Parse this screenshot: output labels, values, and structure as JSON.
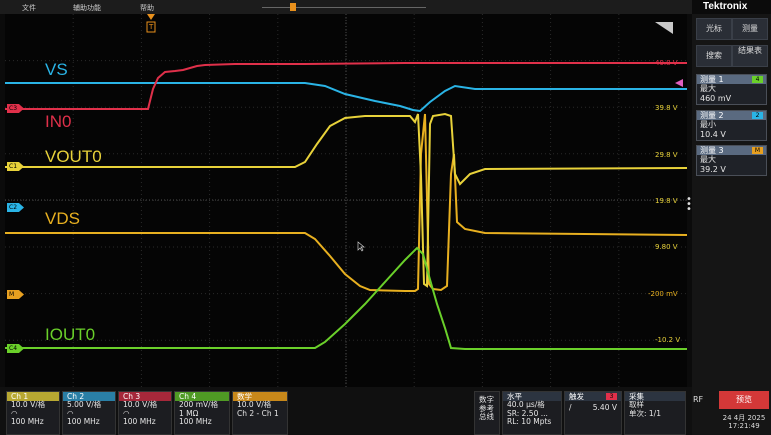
{
  "menu": {
    "file": "文件",
    "assist": "辅助功能",
    "help": "帮助"
  },
  "brand": "Tektronix",
  "signals": [
    {
      "id": "vs",
      "label": "VS",
      "color": "#2ab4e6"
    },
    {
      "id": "in0",
      "label": "IN0",
      "color": "#e0304a"
    },
    {
      "id": "vout0",
      "label": "VOUT0",
      "color": "#e8d23a"
    },
    {
      "id": "vds",
      "label": "VDS",
      "color": "#e8b020"
    },
    {
      "id": "iout0",
      "label": "IOUT0",
      "color": "#6ad02a"
    }
  ],
  "scale_labels": [
    "49.8 V",
    "39.8 V",
    "29.8 V",
    "19.8 V",
    "9.80 V",
    "-200 mV",
    "-10.2 V"
  ],
  "channel_markers": [
    "C3",
    "C1",
    "C2",
    "M",
    "C4"
  ],
  "trigger_marker": "T",
  "right_panel": {
    "buttons": [
      "光标",
      "测量",
      "搜索",
      "结果表"
    ],
    "measurements": [
      {
        "title": "测量 1",
        "badge": "4",
        "badge_color": "#6ad02a",
        "kind": "最大",
        "value": "460 mV"
      },
      {
        "title": "测量 2",
        "badge": "2",
        "badge_color": "#2ab4e6",
        "kind": "最小",
        "value": "10.4 V"
      },
      {
        "title": "测量 3",
        "badge": "M",
        "badge_color": "#e8a020",
        "kind": "最大",
        "value": "39.2 V"
      }
    ]
  },
  "channels": [
    {
      "name": "Ch 1",
      "scale": "10.0 V/格",
      "coupling": "◠",
      "bw": "100 MHz",
      "color": "#b8a832"
    },
    {
      "name": "Ch 2",
      "scale": "5.00 V/格",
      "coupling": "◠",
      "bw": "100 MHz",
      "color": "#2a7fa6"
    },
    {
      "name": "Ch 3",
      "scale": "10.0 V/格",
      "coupling": "◠",
      "bw": "100 MHz",
      "color": "#a6283a"
    },
    {
      "name": "Ch 4",
      "scale": "200 mV/格",
      "coupling": "1 MΩ",
      "bw": "100 MHz",
      "color": "#4f9a24"
    }
  ],
  "math": {
    "name": "数学",
    "scale": "10.0 V/格",
    "expr": "Ch 2 - Ch 1",
    "color": "#c8881a"
  },
  "ref_math": [
    "数字",
    "参考",
    "总线"
  ],
  "horizontal": {
    "title": "水平",
    "scale": "40.0 μs/格",
    "sr": "SR: 2.50 ...",
    "rl": "RL: 10 Mpts"
  },
  "trigger": {
    "title": "触发",
    "channel": "3",
    "level": "5.40 V",
    "slope": "/"
  },
  "acquire": {
    "title": "采集",
    "mode": "取样",
    "count": "单次: 1/1"
  },
  "rf": "RF",
  "preview": "预览",
  "date": "24 4月 2025",
  "time": "17:21:49"
}
